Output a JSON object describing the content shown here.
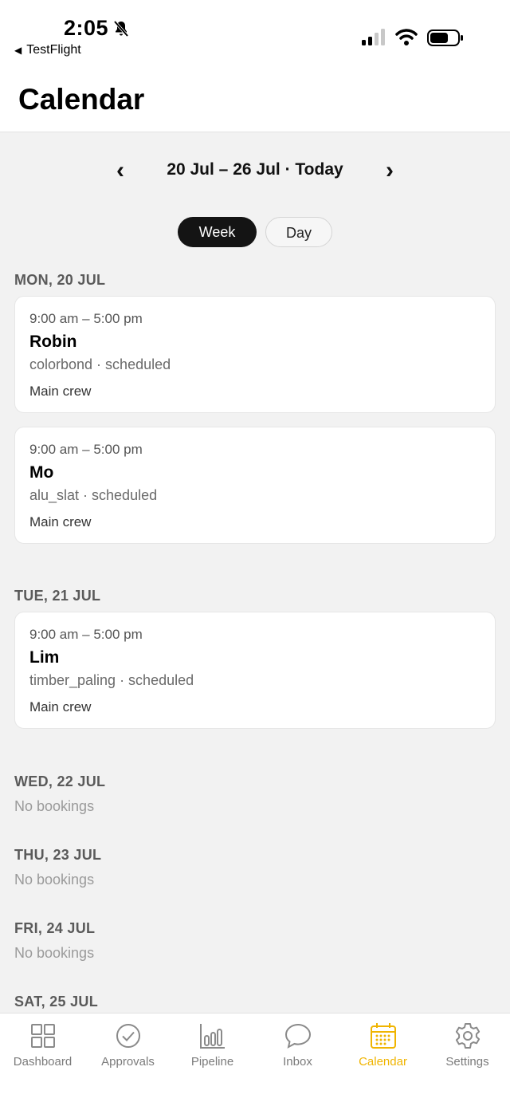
{
  "status": {
    "time": "2:05",
    "back_app": "TestFlight"
  },
  "header": {
    "title": "Calendar"
  },
  "week_nav": {
    "prev": "‹",
    "range": "20 Jul – 26 Jul · Today",
    "next": "›"
  },
  "view_toggle": {
    "week": "Week",
    "day": "Day",
    "selected": "Week"
  },
  "days": [
    {
      "heading": "MON, 20 JUL",
      "bookings": [
        {
          "time": "9:00 am – 5:00 pm",
          "name": "Robin",
          "detail": "colorbond · scheduled",
          "crew": "Main crew"
        },
        {
          "time": "9:00 am – 5:00 pm",
          "name": "Mo",
          "detail": "alu_slat · scheduled",
          "crew": "Main crew"
        }
      ]
    },
    {
      "heading": "TUE, 21 JUL",
      "bookings": [
        {
          "time": "9:00 am – 5:00 pm",
          "name": "Lim",
          "detail": "timber_paling · scheduled",
          "crew": "Main crew"
        }
      ]
    },
    {
      "heading": "WED, 22 JUL",
      "empty": "No bookings"
    },
    {
      "heading": "THU, 23 JUL",
      "empty": "No bookings"
    },
    {
      "heading": "FRI, 24 JUL",
      "empty": "No bookings"
    },
    {
      "heading": "SAT, 25 JUL"
    }
  ],
  "tabs": [
    {
      "label": "Dashboard",
      "icon": "grid-icon"
    },
    {
      "label": "Approvals",
      "icon": "check-circle-icon"
    },
    {
      "label": "Pipeline",
      "icon": "bar-chart-icon"
    },
    {
      "label": "Inbox",
      "icon": "chat-bubble-icon"
    },
    {
      "label": "Calendar",
      "icon": "calendar-icon",
      "active": true
    },
    {
      "label": "Settings",
      "icon": "gear-icon"
    }
  ],
  "colors": {
    "accent": "#f0b400",
    "selected_toggle": "#141414",
    "background": "#f2f2f2"
  }
}
